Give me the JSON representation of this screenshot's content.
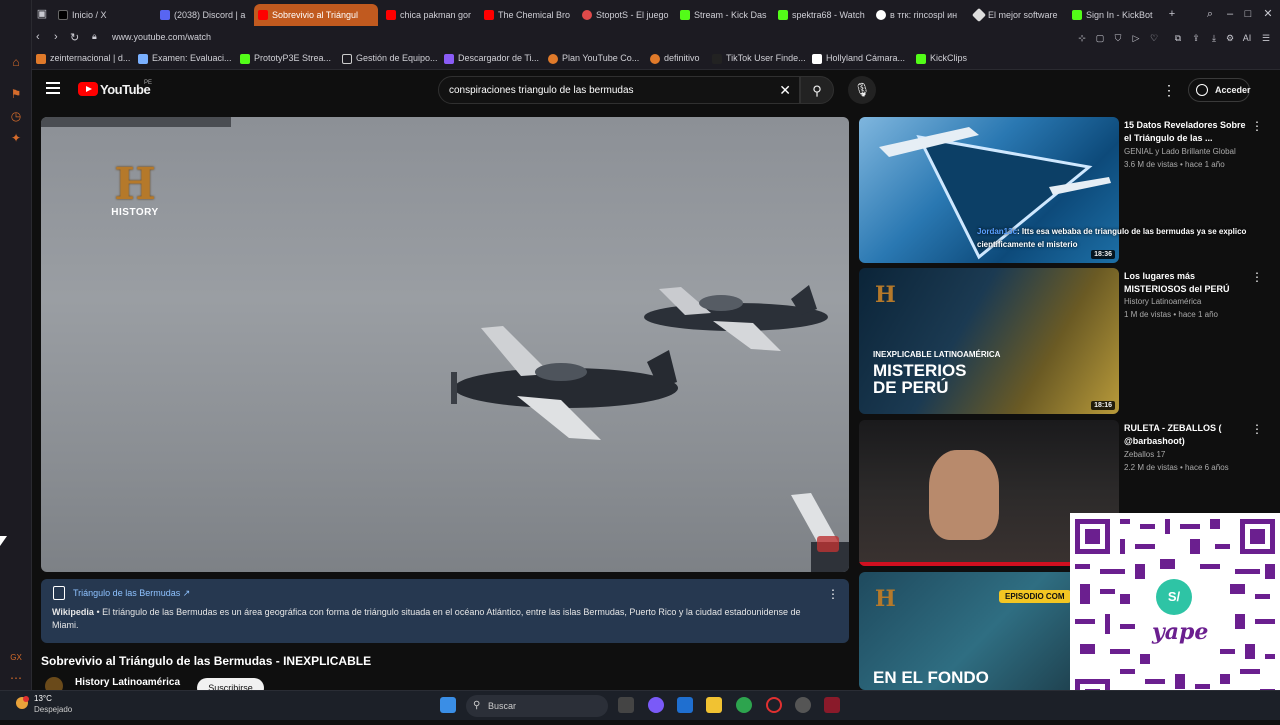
{
  "browser": {
    "tabs": [
      {
        "label": "Inicio / X",
        "active": false,
        "color": "#ffffff"
      },
      {
        "label": "(2038) Discord | a",
        "active": false,
        "color": "#5865f2"
      },
      {
        "label": "Sobrevivio al Triángul",
        "active": true,
        "color": "#ff0000"
      },
      {
        "label": "chica pakman gor",
        "active": false,
        "color": "#ff0000"
      },
      {
        "label": "The Chemical Bro",
        "active": false,
        "color": "#ff0000"
      },
      {
        "label": "StopotS - El juego",
        "active": false,
        "color": "#e04a4a"
      },
      {
        "label": "Stream - Kick Das",
        "active": false,
        "color": "#53fc18"
      },
      {
        "label": "spektra68 - Watch",
        "active": false,
        "color": "#53fc18"
      },
      {
        "label": "в тгк: rincospl ин",
        "active": false,
        "color": "#ffffff"
      },
      {
        "label": "El mejor software",
        "active": false,
        "color": "#ffffff"
      },
      {
        "label": "Sign In - KickBot",
        "active": false,
        "color": "#53fc18"
      }
    ],
    "url": "www.youtube.com/watch",
    "bookmarks": [
      {
        "label": "zeinternacional | d...",
        "color": "#e07a2a"
      },
      {
        "label": "Examen: Evaluaci...",
        "color": "#7ab0ff"
      },
      {
        "label": "PrototyP3E Strea...",
        "color": "#53fc18"
      },
      {
        "label": "Gestión de Equipo...",
        "color": "#cccccc"
      },
      {
        "label": "Descargador de Ti...",
        "color": "#8a5cf6"
      },
      {
        "label": "Plan YouTube Co...",
        "color": "#e07a2a"
      },
      {
        "label": "definitivo",
        "color": "#e07a2a"
      },
      {
        "label": "TikTok User Finde...",
        "color": "#222222"
      },
      {
        "label": "Hollyland Cámara...",
        "color": "#ffffff"
      },
      {
        "label": "KickClips",
        "color": "#53fc18"
      }
    ],
    "ext_ai": "AI"
  },
  "youtube": {
    "logo_text": "YouTube",
    "region": "PE",
    "search_value": "conspiraciones triangulo de las bermudas",
    "login_label": "Acceder"
  },
  "video": {
    "logo_letter": "H",
    "logo_text": "HISTORY",
    "title": "Sobrevivio al Triángulo de las Bermudas - INEXPLICABLE",
    "channel": "History Latinoamérica",
    "subscribe": "Suscribirse"
  },
  "wiki": {
    "title": "Triángulo de las Bermudas",
    "source": "Wikipedia",
    "text": "El triángulo de las Bermudas es un área geográfica con forma de triángulo situada en el océano Atlántico, entre las islas Bermudas, Puerto Rico y la ciudad estadounidense de Miami."
  },
  "recommendations": [
    {
      "title": "15 Datos Reveladores Sobre el Triángulo de las ...",
      "channel": "GENIAL  y Lado Brillante Global",
      "meta": "3.6 M de vistas • hace 1 año",
      "duration": "18:36"
    },
    {
      "title": "Los lugares más MISTERIOSOS del PERÚ",
      "channel": "History Latinoamérica",
      "meta": "1 M de vistas • hace 1 año",
      "duration": "18:16",
      "thumb_tag": "INEXPLICABLE LATINOAMÉRICA",
      "thumb_big": "MISTERIOS DE PERÚ"
    },
    {
      "title": "RULETA - ZEBALLOS ( @barbashoot)",
      "channel": "Zeballos 17",
      "meta": "2.2 M de vistas • hace 6 años"
    },
    {
      "thumb_tag": "EPISODIO COM",
      "thumb_big": "EN EL FONDO"
    }
  ],
  "chat_overlay": {
    "name": "Jordan13c",
    "message": ": Itts esa webaba de triangulo de las bermudas ya se explico cientificamente el misterio"
  },
  "qr": {
    "brand": "yape",
    "badge": "S/"
  },
  "taskbar": {
    "temp": "13°C",
    "weather": "Despejado",
    "search": "Buscar"
  }
}
